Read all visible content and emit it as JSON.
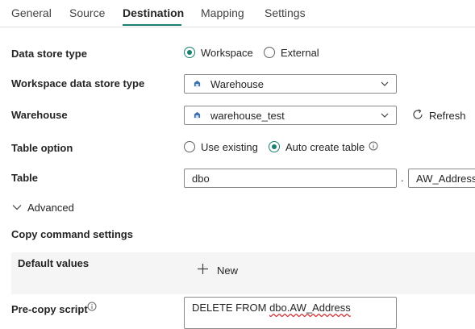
{
  "tabs": [
    {
      "label": "General"
    },
    {
      "label": "Source"
    },
    {
      "label": "Destination"
    },
    {
      "label": "Mapping"
    },
    {
      "label": "Settings"
    }
  ],
  "form": {
    "data_store_type": {
      "label": "Data store type",
      "options": [
        "Workspace",
        "External"
      ],
      "selected": "Workspace"
    },
    "workspace_data_store_type": {
      "label": "Workspace data store type",
      "value": "Warehouse"
    },
    "warehouse": {
      "label": "Warehouse",
      "value": "warehouse_test",
      "refresh_label": "Refresh"
    },
    "table_option": {
      "label": "Table option",
      "options": [
        "Use existing",
        "Auto create table"
      ],
      "selected": "Auto create table"
    },
    "table": {
      "label": "Table",
      "schema": "dbo",
      "separator": ".",
      "name": "AW_Address"
    },
    "advanced_label": "Advanced",
    "copy_command_settings_label": "Copy command settings",
    "default_values": {
      "label": "Default values",
      "new_label": "New"
    },
    "pre_copy_script": {
      "label": "Pre-copy script",
      "value_prefix": "DELETE FROM ",
      "value_spellcheck": "dbo.AW_Address"
    }
  },
  "colors": {
    "accent": "#1a7f6f",
    "text": "#242424",
    "section_bg": "#f5f5f5"
  },
  "icons": [
    "info-icon",
    "refresh-icon",
    "chevron-down-icon",
    "warehouse-icon",
    "plus-icon"
  ]
}
